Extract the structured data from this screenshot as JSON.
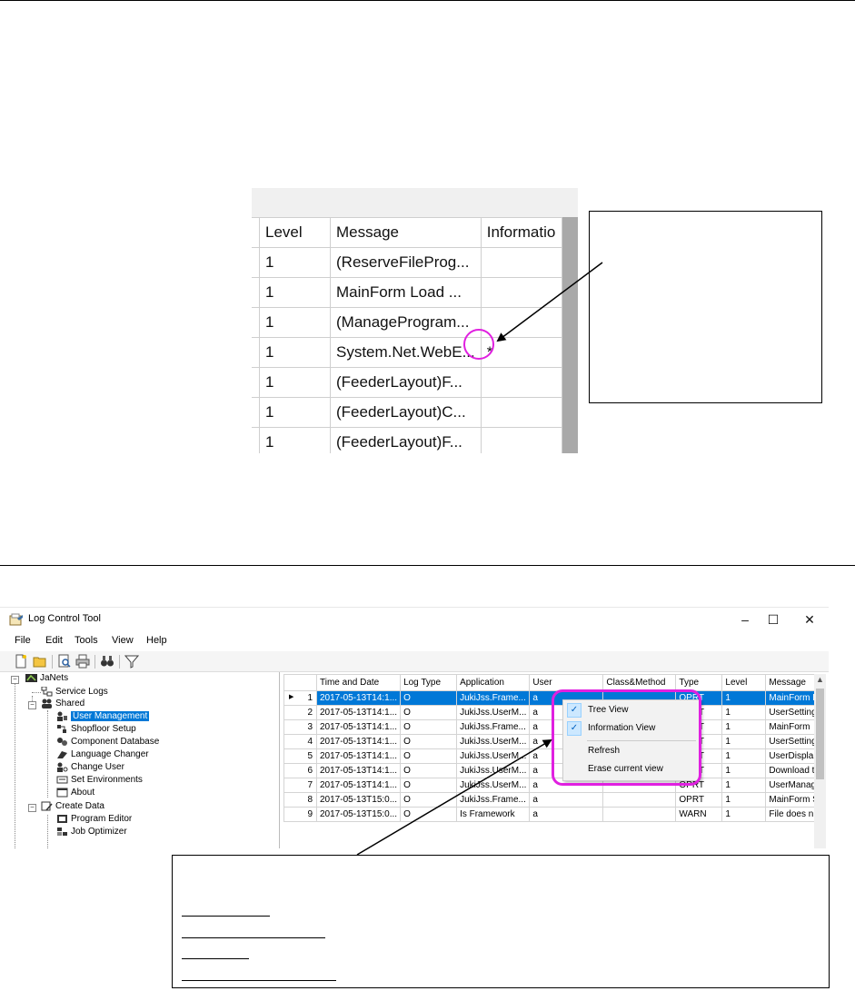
{
  "zoom_grid": {
    "headers": [
      "Level",
      "Message",
      "Informatio"
    ],
    "rows": [
      {
        "level": "1",
        "message": "(ReserveFileProg...",
        "info": ""
      },
      {
        "level": "1",
        "message": "MainForm Load ...",
        "info": ""
      },
      {
        "level": "1",
        "message": "(ManageProgram...",
        "info": ""
      },
      {
        "level": "1",
        "message": "System.Net.WebE...",
        "info": "*"
      },
      {
        "level": "1",
        "message": "(FeederLayout)F...",
        "info": ""
      },
      {
        "level": "1",
        "message": "(FeederLayout)C...",
        "info": ""
      },
      {
        "level": "1",
        "message": "(FeederLayout)F...",
        "info": ""
      }
    ]
  },
  "window": {
    "title": "Log Control Tool",
    "controls": {
      "minimize": "–",
      "maximize": "☐",
      "close": "✕"
    },
    "menu": [
      "File",
      "Edit",
      "Tools",
      "View",
      "Help"
    ]
  },
  "tree": {
    "root": "JaNets",
    "service_logs": "Service Logs",
    "shared": "Shared",
    "shared_items": [
      "User Management",
      "Shopfloor Setup",
      "Component Database",
      "Language Changer",
      "Change User",
      "Set Environments",
      "About"
    ],
    "create_data": "Create Data",
    "create_items": [
      "Program Editor",
      "Job Optimizer"
    ]
  },
  "grid": {
    "headers": [
      "",
      "Time and Date",
      "Log Type",
      "Application",
      "User",
      "Class&Method",
      "Type",
      "Level",
      "Message"
    ],
    "rows": [
      [
        "1",
        "2017-05-13T14:1...",
        "O",
        "JukiJss.Frame...",
        "a",
        "",
        "OPRT",
        "1",
        "MainForm L"
      ],
      [
        "2",
        "2017-05-13T14:1...",
        "O",
        "JukiJss.UserM...",
        "a",
        "",
        "OPRT",
        "1",
        "UserSetting"
      ],
      [
        "3",
        "2017-05-13T14:1...",
        "O",
        "JukiJss.Frame...",
        "a",
        "",
        "OPRT",
        "1",
        "MainForm"
      ],
      [
        "4",
        "2017-05-13T14:1...",
        "O",
        "JukiJss.UserM...",
        "a",
        "",
        "OPRT",
        "1",
        "UserSetting"
      ],
      [
        "5",
        "2017-05-13T14:1...",
        "O",
        "JukiJss.UserM...",
        "a",
        "",
        "OPRT",
        "1",
        "UserDispla"
      ],
      [
        "6",
        "2017-05-13T14:1...",
        "O",
        "JukiJss.UserM...",
        "a",
        "",
        "OPRT",
        "1",
        "Download t"
      ],
      [
        "7",
        "2017-05-13T14:1...",
        "O",
        "JukiJss.UserM...",
        "a",
        "",
        "OPRT",
        "1",
        "UserManag"
      ],
      [
        "8",
        "2017-05-13T15:0...",
        "O",
        "JukiJss.Frame...",
        "a",
        "",
        "OPRT",
        "1",
        "MainForm S"
      ],
      [
        "9",
        "2017-05-13T15:0...",
        "O",
        "Is Framework",
        "a",
        "",
        "WARN",
        "1",
        "File does n"
      ]
    ],
    "selected_row": 0
  },
  "context_menu": {
    "items": [
      {
        "label": "Tree View",
        "checked": true
      },
      {
        "label": "Information View",
        "checked": true
      },
      {
        "label": "Refresh",
        "checked": false
      },
      {
        "label": "Erase current view",
        "checked": false
      }
    ]
  },
  "colors": {
    "highlight_ring": "#e020e0",
    "selection": "#0078d7"
  }
}
